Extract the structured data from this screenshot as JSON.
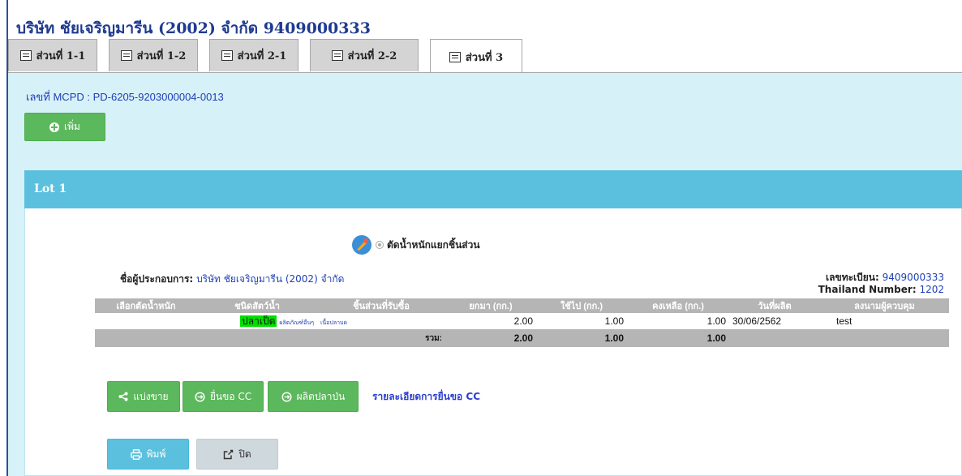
{
  "company": {
    "title": "บริษัท ชัยเจริญมารีน (2002) จำกัด 9409000333"
  },
  "tabs": [
    {
      "label": "ส่วนที่ 1-1",
      "active": false
    },
    {
      "label": "ส่วนที่ 1-2",
      "active": false
    },
    {
      "label": "ส่วนที่ 2-1",
      "active": false
    },
    {
      "label": "ส่วนที่ 2-2",
      "active": false
    },
    {
      "label": "ส่วนที่ 3",
      "active": true
    }
  ],
  "mcpd": "เลขที่ MCPD : PD-6205-9203000004-0013",
  "add_button": "เพิ่ม",
  "lot": {
    "title": "Lot 1",
    "cut_label": "ตัดน้ำหนักแยกชิ้นส่วน",
    "operator_label": "ชื่อผู้ประกอบการ:",
    "operator_value": "บริษัท ชัยเจริญมารีน (2002) จำกัด",
    "registration_label": "เลขทะเบียน:",
    "registration_value": "9409000333",
    "thailand_number_label": "Thailand Number:",
    "thailand_number_value": "1202",
    "columns": [
      "เลือกตัดน้ำหนัก",
      "ชนิดสัตว์น้ำ",
      "ชิ้นส่วนที่รับซื้อ",
      "ยกมา (กก.)",
      "ใช้ไป (กก.)",
      "คงเหลือ (กก.)",
      "วันที่ผลิต",
      "ลงนามผู้ควบคุม"
    ],
    "rows": [
      {
        "species": "ปลาเป็ด",
        "species_note": "ผลิตภัณฑ์อื่นๆ",
        "part": "เนื้อปลาบด",
        "brought": "2.00",
        "used": "1.00",
        "remain": "1.00",
        "date": "30/06/2562",
        "signer": "test"
      }
    ],
    "total": {
      "label": "รวม:",
      "brought": "2.00",
      "used": "1.00",
      "remain": "1.00"
    }
  },
  "actions": {
    "split": "แบ่งขาย",
    "request_cc": "ยื่นขอ CC",
    "fishmeal": "ผลิตปลาป่น",
    "cc_details": "รายละเอียดการยื่นขอ CC",
    "print": "พิมพ์",
    "close": "ปิด"
  },
  "colors": {
    "title": "#1f3b8f",
    "link": "#1f3fb6",
    "panel": "#d7f1f8",
    "header": "#5bc0de",
    "green": "#5cb85c",
    "table_header": "#b5b5b5",
    "highlight": "#00e000"
  },
  "icons": [
    "table-icon",
    "plus-circle-icon",
    "cut-badge-icon",
    "share-icon",
    "circle-arrow-icon",
    "print-icon",
    "external-close-icon"
  ]
}
